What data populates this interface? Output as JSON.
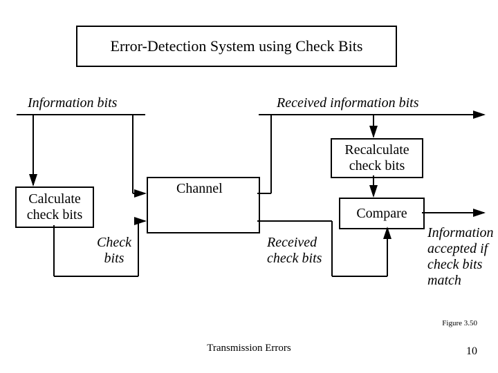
{
  "title": "Error-Detection System using Check Bits",
  "labels": {
    "info_bits": "Information bits",
    "recv_info_bits": "Received information bits",
    "recalculate": "Recalculate\ncheck bits",
    "channel": "Channel",
    "calculate": "Calculate\ncheck bits",
    "compare": "Compare",
    "check_bits": "Check\nbits",
    "recv_check_bits": "Received\ncheck bits",
    "result": "Information\naccepted if\ncheck bits\nmatch"
  },
  "footer": {
    "caption": "Transmission Errors",
    "figure": "Figure 3.50",
    "page": "10"
  }
}
